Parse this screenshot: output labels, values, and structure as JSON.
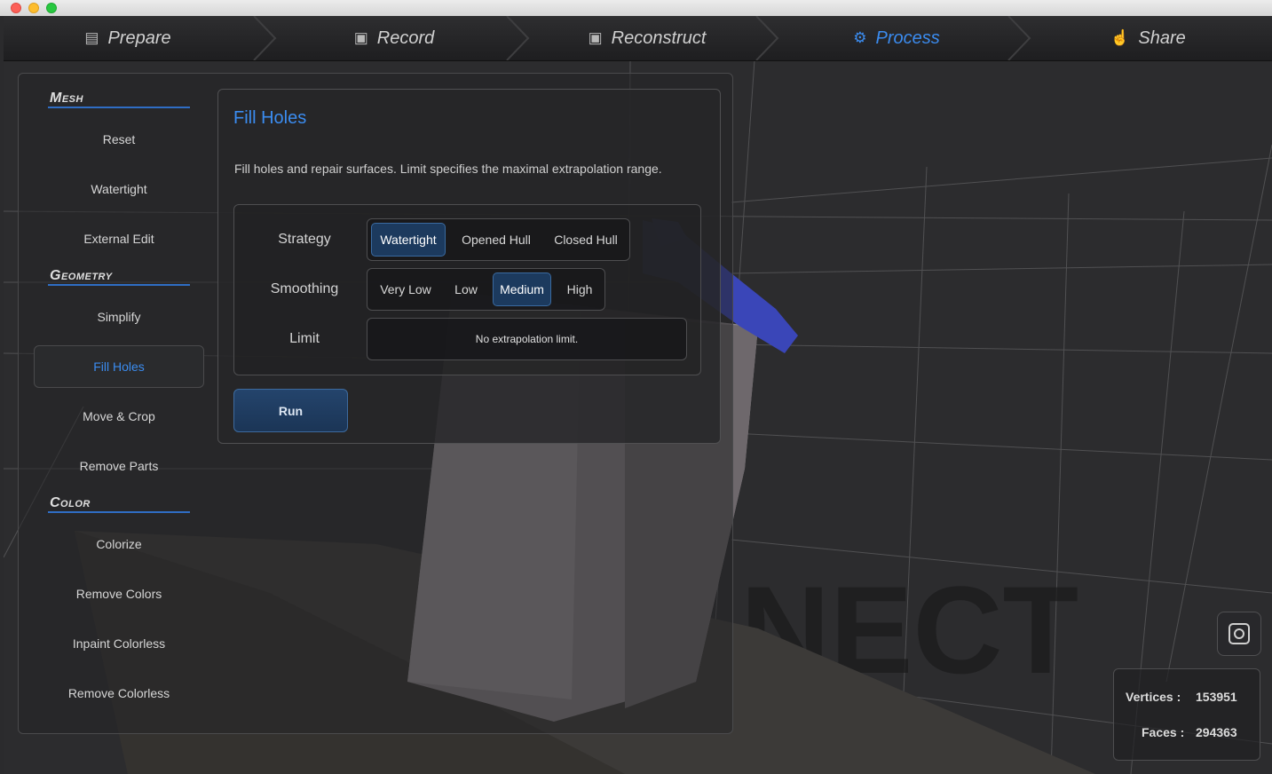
{
  "nav": {
    "items": [
      {
        "label": "Prepare",
        "icon": "prepare-icon",
        "glyph": "▤"
      },
      {
        "label": "Record",
        "icon": "film-icon",
        "glyph": "▣"
      },
      {
        "label": "Reconstruct",
        "icon": "film-icon",
        "glyph": "▣"
      },
      {
        "label": "Process",
        "icon": "gears-icon",
        "glyph": "⚙"
      },
      {
        "label": "Share",
        "icon": "thumbs-up-icon",
        "glyph": "☝"
      }
    ],
    "active": "Process",
    "active_color": "#3b8cf0"
  },
  "sidebar": {
    "sections": [
      {
        "title": "Mesh",
        "items": [
          "Reset",
          "Watertight",
          "External Edit"
        ]
      },
      {
        "title": "Geometry",
        "items": [
          "Simplify",
          "Fill Holes",
          "Move & Crop",
          "Remove Parts"
        ]
      },
      {
        "title": "Color",
        "items": [
          "Colorize",
          "Remove Colors",
          "Inpaint Colorless",
          "Remove Colorless"
        ]
      }
    ],
    "active_item": "Fill Holes"
  },
  "fill_holes": {
    "title": "Fill Holes",
    "description": "Fill holes and repair surfaces. Limit specifies the maximal extrapolation range.",
    "strategy": {
      "label": "Strategy",
      "options": [
        "Watertight",
        "Opened Hull",
        "Closed Hull"
      ],
      "selected": "Watertight"
    },
    "smoothing": {
      "label": "Smoothing",
      "options": [
        "Very Low",
        "Low",
        "Medium",
        "High"
      ],
      "selected": "Medium"
    },
    "limit": {
      "label": "Limit",
      "value": "No extrapolation limit."
    },
    "run_label": "Run"
  },
  "stats": {
    "vertices_label": "Vertices :",
    "vertices_value": "153951",
    "faces_label": "Faces :",
    "faces_value": "294363"
  },
  "watermark": "NECT"
}
